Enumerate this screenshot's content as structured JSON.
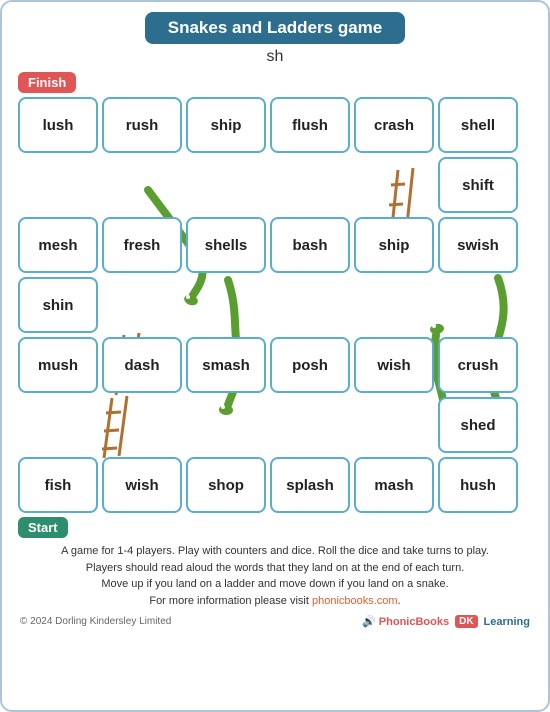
{
  "title": "Snakes and Ladders game",
  "subtitle": "sh",
  "finish_label": "Finish",
  "start_label": "Start",
  "grid_rows": [
    [
      "lush",
      "rush",
      "ship",
      "flush",
      "crash",
      "shell"
    ],
    [
      "",
      "",
      "",
      "",
      "",
      "shift"
    ],
    [
      "mesh",
      "fresh",
      "shells",
      "bash",
      "ship",
      "swish"
    ],
    [
      "shin",
      "",
      "",
      "",
      "",
      ""
    ],
    [
      "mush",
      "dash",
      "smash",
      "posh",
      "wish",
      "crush"
    ],
    [
      "",
      "",
      "",
      "",
      "",
      "shed"
    ],
    [
      "fish",
      "wish",
      "shop",
      "splash",
      "mash",
      "hush"
    ]
  ],
  "instructions_line1": "A game for 1-4 players. Play with counters and dice. Roll the dice and take turns to play.",
  "instructions_line2": "Players should read aloud the words that they land on at the end of each turn.",
  "instructions_line3": "Move up if you land on a ladder and move down if you land on a snake.",
  "instructions_line4": "For more information please visit ",
  "instructions_link": "phonicbooks.com",
  "footer_copyright": "© 2024 Dorling Kindersley Limited",
  "footer_phonic": "PhonicBooks",
  "footer_dk": "DK",
  "footer_learning": "Learning"
}
